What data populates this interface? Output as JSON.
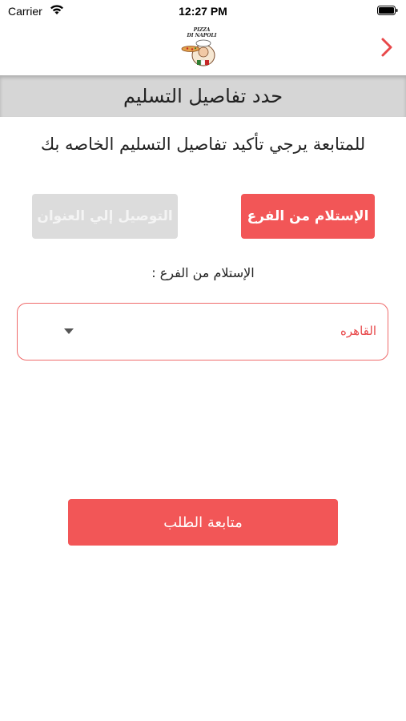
{
  "status_bar": {
    "carrier": "Carrier",
    "time": "12:27 PM",
    "wifi_icon": "wifi-icon",
    "battery_icon": "battery-icon"
  },
  "nav": {
    "logo_text_line1": "PIZZA",
    "logo_text_line2": "DI NAPOLI",
    "forward_icon": "chevron-right-icon",
    "accent_color": "#e8484a"
  },
  "page": {
    "title": "حدد تفاصيل التسليم",
    "instruction": "للمتابعة يرجي تأكيد تفاصيل التسليم الخاصه بك"
  },
  "delivery_options": {
    "pickup_label": "الإستلام من الفرع",
    "delivery_label": "التوصيل إلي العنوان",
    "selected": "pickup",
    "active_color": "#f25657",
    "inactive_color": "#dcdcdc"
  },
  "branch": {
    "label": "الإستلام من الفرع :",
    "selected_value": "القاهره",
    "dropdown_icon": "caret-down-icon"
  },
  "actions": {
    "continue_label": "متابعة الطلب"
  }
}
